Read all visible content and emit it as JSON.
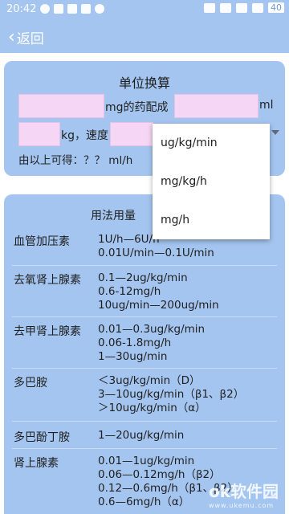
{
  "status_bar": {
    "time": "20:42",
    "battery": "40"
  },
  "nav": {
    "back_label": "返回"
  },
  "converter": {
    "title": "单位换算",
    "text_mg_drug": "mg的药配成",
    "text_ml": "ml",
    "text_kg": "kg，速度",
    "result_text": "由以上可得：？？ ml/h"
  },
  "dropdown": {
    "options": [
      "ug/kg/min",
      "mg/kg/h",
      "mg/h"
    ]
  },
  "usage": {
    "header": "用法用量",
    "rows": [
      {
        "name": "血管加压素",
        "values": [
          "1U/h—6U/h",
          "0.01U/min—0.1U/min"
        ]
      },
      {
        "name": "去氧肾上腺素",
        "values": [
          "0.1—2ug/kg/min",
          "0.6-12mg/h",
          "10ug/min—200ug/min"
        ]
      },
      {
        "name": "去甲肾上腺素",
        "values": [
          "0.01—0.3ug/kg/min",
          "0.06-1.8mg/h",
          "1—30ug/min"
        ]
      },
      {
        "name": "多巴胺",
        "values": [
          "＜3ug/kg/min（D）",
          "3—10ug/kg/min（β1、β2）",
          "＞10ug/kg/min（α）"
        ]
      },
      {
        "name": "多巴酚丁胺",
        "values": [
          "1—20ug/kg/min"
        ]
      },
      {
        "name": "肾上腺素",
        "values": [
          "0.01—1ug/kg/min",
          "0.06—0.12mg/h（β2）",
          "0.12—0.6mg/h（β1、β2）",
          "0.6—6mg/h（α）"
        ]
      }
    ]
  },
  "watermark": {
    "main": "ok软件园",
    "sub": "www.ukemu.com"
  }
}
